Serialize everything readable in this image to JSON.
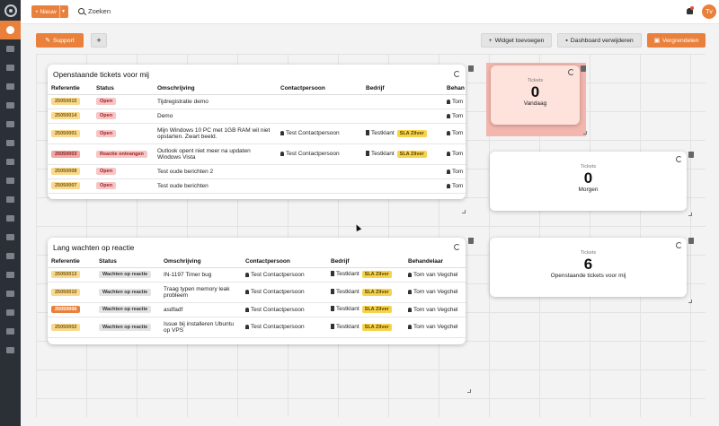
{
  "topbar": {
    "new_label": "+ Nieuw",
    "search_label": "Zoeken",
    "avatar_initials": "Tv"
  },
  "toolbar": {
    "support_label": "Support",
    "add_label": "+",
    "add_widget_label": "Widget toevoegen",
    "remove_dashboard_label": "Dashboard verwijderen",
    "lock_label": "Vergrendelen"
  },
  "widget_open": {
    "title": "Openstaande tickets voor mij",
    "columns": [
      "Referentie",
      "Status",
      "Omschrijving",
      "Contactpersoon",
      "Bedrijf",
      "Behan"
    ],
    "rows": [
      {
        "ref": "25050015",
        "ref_color": "yellow",
        "status": "Open",
        "desc": "Tijdregistratie demo",
        "contact": "",
        "company": "",
        "sla": "",
        "handler": "Tom"
      },
      {
        "ref": "25050014",
        "ref_color": "yellow",
        "status": "Open",
        "desc": "Demo",
        "contact": "",
        "company": "",
        "sla": "",
        "handler": "Tom"
      },
      {
        "ref": "25050001",
        "ref_color": "yellow",
        "status": "Open",
        "desc": "Mijn Windows 10 PC met 1GB RAM wil niet opstarten. Zwart beeld.",
        "contact": "Test Contactpersoon",
        "company": "Testklant",
        "sla": "SLA Zilver",
        "handler": "Tom"
      },
      {
        "ref": "25050003",
        "ref_color": "red",
        "status": "Reactie ontvangen",
        "desc": "Outlook opent niet meer na updaten Windows Vista",
        "contact": "Test Contactpersoon",
        "company": "Testklant",
        "sla": "SLA Zilver",
        "handler": "Tom"
      },
      {
        "ref": "25050008",
        "ref_color": "yellow",
        "status": "Open",
        "desc": "Test oude berichten 2",
        "contact": "",
        "company": "",
        "sla": "",
        "handler": "Tom"
      },
      {
        "ref": "25050007",
        "ref_color": "yellow",
        "status": "Open",
        "desc": "Test oude berichten",
        "contact": "",
        "company": "",
        "sla": "",
        "handler": "Tom"
      }
    ]
  },
  "widget_wait": {
    "title": "Lang wachten op reactie",
    "columns": [
      "Referentie",
      "Status",
      "Omschrijving",
      "Contactpersoon",
      "Bedrijf",
      "Behandelaar"
    ],
    "rows": [
      {
        "ref": "25050013",
        "ref_color": "yellow",
        "status": "Wachten op reactie",
        "desc": "IN-1197 Timer bug",
        "contact": "Test Contactpersoon",
        "company": "Testklant",
        "sla": "SLA Zilver",
        "handler": "Tom van Vegchel"
      },
      {
        "ref": "25050010",
        "ref_color": "yellow",
        "status": "Wachten op reactie",
        "desc": "Traag typen memory leak probleem",
        "contact": "Test Contactpersoon",
        "company": "Testklant",
        "sla": "SLA Zilver",
        "handler": "Tom van Vegchel"
      },
      {
        "ref": "25050006",
        "ref_color": "orange",
        "status": "Wachten op reactie",
        "desc": "asdfadf",
        "contact": "Test Contactpersoon",
        "company": "Testklant",
        "sla": "SLA Zilver",
        "handler": "Tom van Vegchel"
      },
      {
        "ref": "25050002",
        "ref_color": "yellow",
        "status": "Wachten op reactie",
        "desc": "Issue bij installeren Ubuntu op VPS",
        "contact": "Test Contactpersoon",
        "company": "Testklant",
        "sla": "SLA Zilver",
        "handler": "Tom van Vegchel"
      }
    ]
  },
  "stat_today": {
    "label": "Tickets",
    "value": "0",
    "sub": "Vandaag"
  },
  "stat_tomorrow": {
    "label": "Tickets",
    "value": "0",
    "sub": "Morgen"
  },
  "stat_open": {
    "label": "Tickets",
    "value": "6",
    "sub": "Openstaande tickets voor mij"
  },
  "colors": {
    "accent": "#e9813c",
    "sidebar": "#2b2f36",
    "highlight": "#f2b6ae"
  }
}
